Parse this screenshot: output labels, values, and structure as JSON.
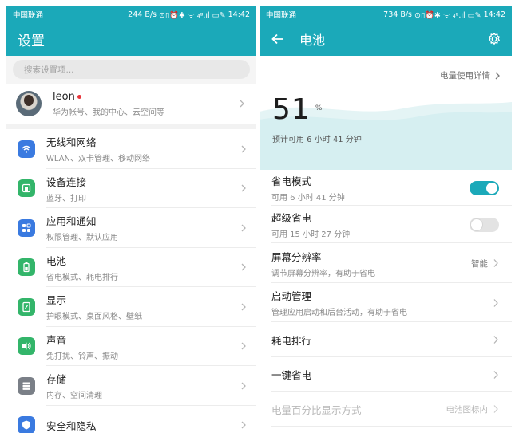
{
  "colors": {
    "accent": "#1ba9b9",
    "toggle_off": "#e3e3e3",
    "alert_dot": "#e8353b",
    "wave_fill": "#d6eff1"
  },
  "left": {
    "status": {
      "carrier": "中国联通",
      "speed": "244 B/s",
      "battery": "14:42"
    },
    "title": "设置",
    "search_placeholder": "搜索设置项...",
    "account": {
      "name": "leon",
      "subtitle": "华为帐号、我的中心、云空间等"
    },
    "items": [
      {
        "title": "无线和网络",
        "subtitle": "WLAN、双卡管理、移动网络",
        "icon": "wifi-icon",
        "color": "#3a7ae0"
      },
      {
        "title": "设备连接",
        "subtitle": "蓝牙、打印",
        "icon": "device-connect-icon",
        "color": "#33b56a"
      },
      {
        "title": "应用和通知",
        "subtitle": "权限管理、默认应用",
        "icon": "apps-grid-icon",
        "color": "#3a7ae0"
      },
      {
        "title": "电池",
        "subtitle": "省电模式、耗电排行",
        "icon": "battery-icon",
        "color": "#33b56a"
      },
      {
        "title": "显示",
        "subtitle": "护眼模式、桌面风格、壁纸",
        "icon": "display-icon",
        "color": "#33b56a"
      },
      {
        "title": "声音",
        "subtitle": "免打扰、铃声、振动",
        "icon": "speaker-icon",
        "color": "#33b56a"
      },
      {
        "title": "存储",
        "subtitle": "内存、空间清理",
        "icon": "storage-icon",
        "color": "#7a7f87"
      },
      {
        "title": "安全和隐私",
        "subtitle": "",
        "icon": "shield-icon",
        "color": "#3a7ae0"
      }
    ]
  },
  "right": {
    "status": {
      "carrier": "中国联通",
      "speed": "734 B/s",
      "battery": "14:42"
    },
    "title": "电池",
    "usage_link": "电量使用详情",
    "percent": "51",
    "percent_unit": "%",
    "estimate": "预计可用 6 小时 41 分钟",
    "rows": [
      {
        "title": "省电模式",
        "subtitle": "可用 6 小时 41 分钟",
        "control": "toggle",
        "state": "on"
      },
      {
        "title": "超级省电",
        "subtitle": "可用 15 小时 27 分钟",
        "control": "toggle",
        "state": "off"
      },
      {
        "title": "屏幕分辨率",
        "subtitle": "调节屏幕分辨率，有助于省电",
        "control": "chevron",
        "value": "智能"
      },
      {
        "title": "启动管理",
        "subtitle": "管理应用启动和后台活动，有助于省电",
        "control": "chevron",
        "value": ""
      },
      {
        "title": "耗电排行",
        "subtitle": "",
        "control": "chevron",
        "value": ""
      },
      {
        "title": "一键省电",
        "subtitle": "",
        "control": "chevron",
        "value": ""
      },
      {
        "title": "电量百分比显示方式",
        "subtitle": "",
        "control": "chevron",
        "value": "电池图标内",
        "disabled": true
      }
    ]
  }
}
